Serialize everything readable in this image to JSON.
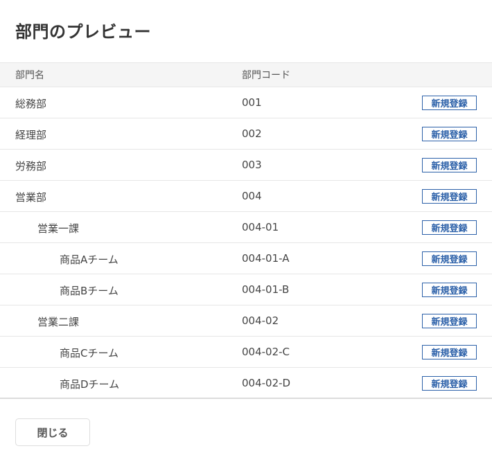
{
  "dialog": {
    "title": "部門のプレビュー",
    "close_label": "閉じる"
  },
  "table": {
    "columns": {
      "name": "部門名",
      "code": "部門コード"
    },
    "register_label": "新規登録",
    "rows": [
      {
        "name": "総務部",
        "code": "001",
        "level": 0
      },
      {
        "name": "経理部",
        "code": "002",
        "level": 0
      },
      {
        "name": "労務部",
        "code": "003",
        "level": 0
      },
      {
        "name": "営業部",
        "code": "004",
        "level": 0
      },
      {
        "name": "営業一課",
        "code": "004-01",
        "level": 1
      },
      {
        "name": "商品Aチーム",
        "code": "004-01-A",
        "level": 2
      },
      {
        "name": "商品Bチーム",
        "code": "004-01-B",
        "level": 2
      },
      {
        "name": "営業二課",
        "code": "004-02",
        "level": 1
      },
      {
        "name": "商品Cチーム",
        "code": "004-02-C",
        "level": 2
      },
      {
        "name": "商品Dチーム",
        "code": "004-02-D",
        "level": 2
      }
    ]
  },
  "colors": {
    "accent": "#2a5fa8",
    "header_bg": "#f5f5f5",
    "border": "#e6e6e6"
  }
}
